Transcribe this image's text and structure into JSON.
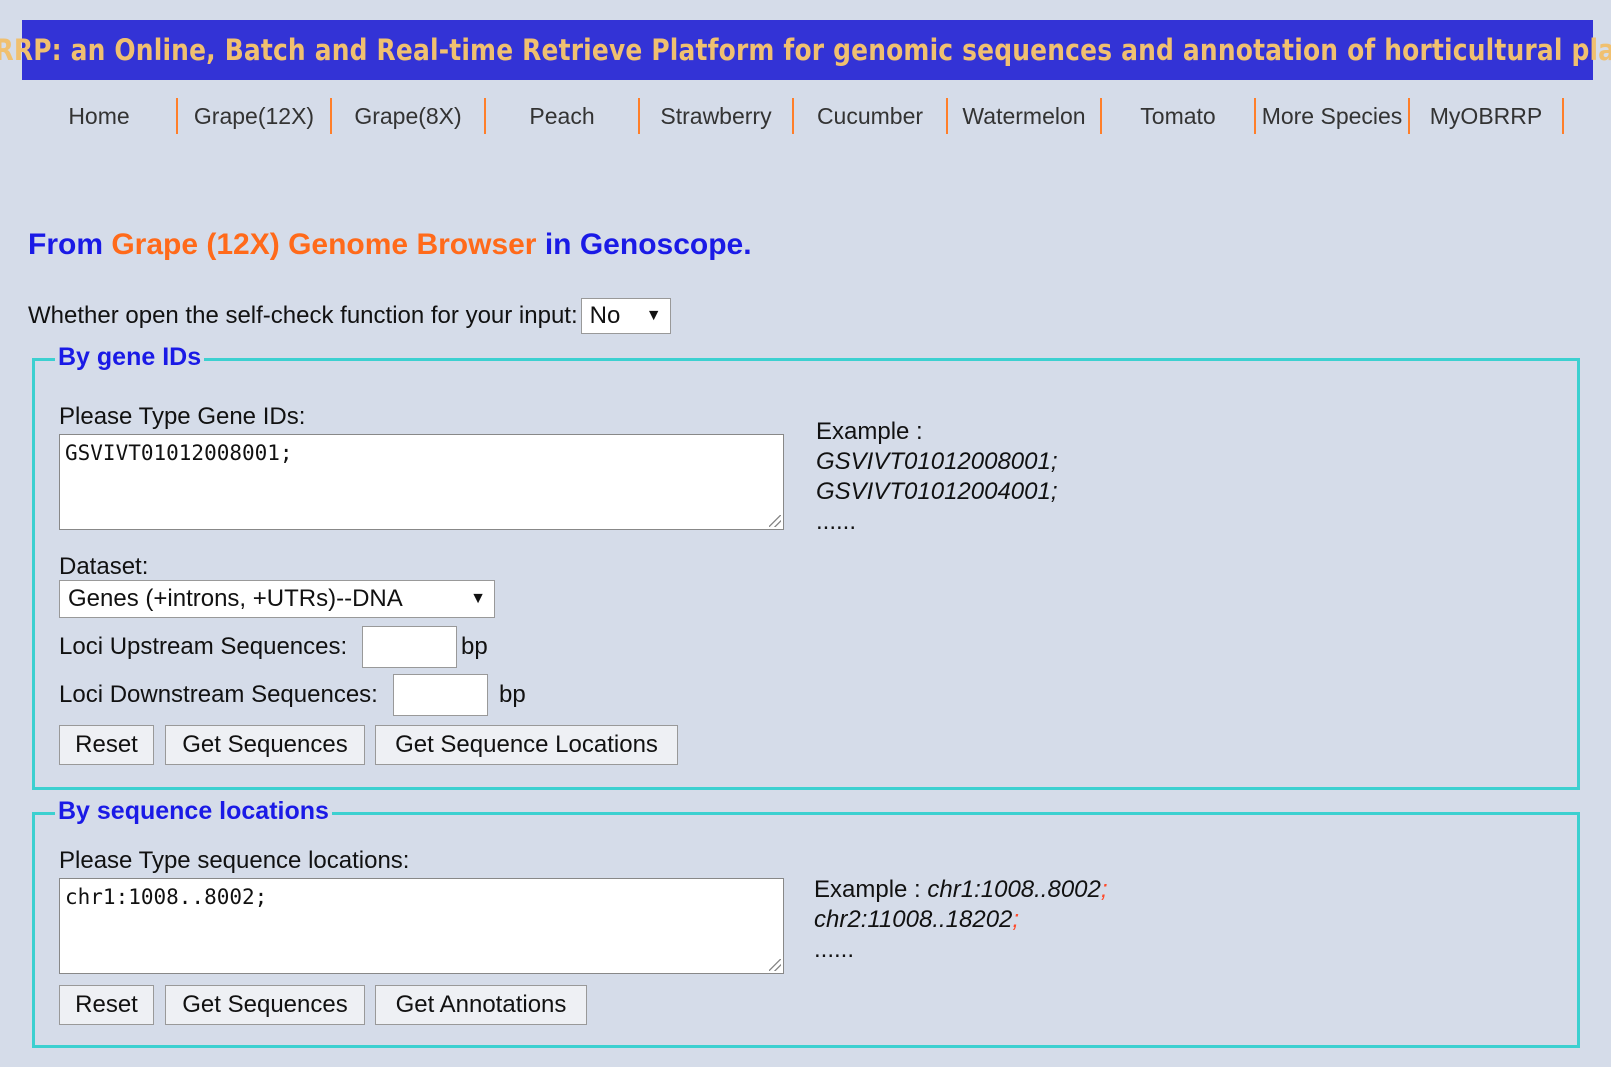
{
  "banner": {
    "title": "OBRRP: an Online, Batch and Real-time Retrieve Platform for genomic sequences and annotation of horticultural plants"
  },
  "nav": [
    "Home",
    "Grape(12X)",
    "Grape(8X)",
    "Peach",
    "Strawberry",
    "Cucumber",
    "Watermelon",
    "Tomato",
    "More Species",
    "MyOBRRP"
  ],
  "heading": {
    "from": "From ",
    "browser": "Grape (12X) Genome Browser",
    "in": " in ",
    "site": "Genoscope."
  },
  "selfcheck": {
    "label": "Whether open the self-check function for your input:",
    "value": "No"
  },
  "gene_section": {
    "legend": "By gene IDs",
    "type_label": "Please Type Gene IDs:",
    "textarea_value": "GSVIVT01012008001;",
    "example_label": "Example :",
    "example_lines": [
      "GSVIVT01012008001;",
      "GSVIVT01012004001;",
      "......"
    ],
    "dataset_label": "Dataset:",
    "dataset_value": "Genes (+introns, +UTRs)--DNA",
    "upstream_label": "Loci Upstream Sequences:",
    "upstream_value": "",
    "upstream_unit": "bp",
    "downstream_label": "Loci Downstream Sequences:",
    "downstream_value": "",
    "downstream_unit": "bp",
    "reset_label": "Reset",
    "get_sequences_label": "Get Sequences",
    "get_locations_label": "Get Sequence Locations"
  },
  "location_section": {
    "legend": "By sequence locations",
    "type_label": "Please Type sequence locations:",
    "textarea_value": "chr1:1008..8002;",
    "example_label": "Example : ",
    "example_line1": "chr1:1008..8002",
    "example_line2": "chr2:11008..18202",
    "example_semicolon": ";",
    "example_more": "......",
    "reset_label": "Reset",
    "get_sequences_label": "Get Sequences",
    "get_annotations_label": "Get Annotations"
  },
  "colors": {
    "banner_bg": "#3333d6",
    "banner_text": "#f0c070",
    "accent_blue": "#1a1ae6",
    "accent_orange": "#ff6a1a",
    "fieldset_border": "#3cd0d0",
    "page_bg": "#d5dce9"
  },
  "icons": {
    "dropdown": "triangle-down-icon",
    "resize": "resize-grip-icon"
  }
}
